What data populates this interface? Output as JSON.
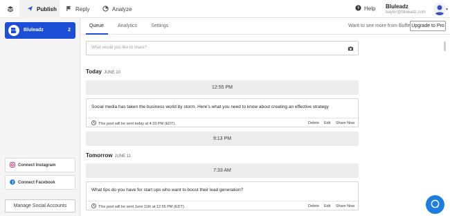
{
  "nav": {
    "tabs": [
      {
        "label": "Publish",
        "icon": "paper-plane-icon",
        "active": true
      },
      {
        "label": "Reply",
        "icon": "reply-flag-icon",
        "active": false
      },
      {
        "label": "Analyze",
        "icon": "pie-chart-icon",
        "active": false
      }
    ],
    "help_label": "Help",
    "account": {
      "name": "Bluleadz",
      "email": "baylor@bluleadz.com"
    }
  },
  "sidebar": {
    "profile": {
      "name": "Bluleadz",
      "count": "2"
    },
    "connect_instagram": "Connect Instagram",
    "connect_facebook": "Connect Facebook",
    "manage_label": "Manage Social Accounts"
  },
  "main": {
    "subtabs": [
      {
        "label": "Queue",
        "active": true
      },
      {
        "label": "Analytics",
        "active": false
      },
      {
        "label": "Settings",
        "active": false
      }
    ],
    "upsell_text": "Want to see more from Buffer?",
    "upgrade_label": "Upgrade to Pro",
    "composer_placeholder": "What would you like to share?",
    "days": [
      {
        "label": "Today",
        "date": "JUNE 10"
      },
      {
        "label": "Tomorrow",
        "date": "JUNE 11"
      }
    ],
    "slots": [
      "12:55 PM",
      "9:13 PM",
      "7:33 AM"
    ],
    "posts": [
      {
        "text": "Social media has taken the business world by storm. Here's what you need to know about creating an effective strategy",
        "meta": "This post will be sent today at 4:33 PM (EDT).",
        "actions": [
          "Delete",
          "Edit",
          "Share Now"
        ]
      },
      {
        "text": "What tips do you have for start ups who want to boost their lead generation?",
        "meta": "This post will be sent June 11th at 12:55 PM (EDT).",
        "actions": [
          "Delete",
          "Edit",
          "Share Now"
        ]
      }
    ]
  },
  "colors": {
    "accent": "#1d4ed8",
    "chat": "#1d7de0",
    "instagram": "#e1306c",
    "facebook": "#1877f2"
  }
}
